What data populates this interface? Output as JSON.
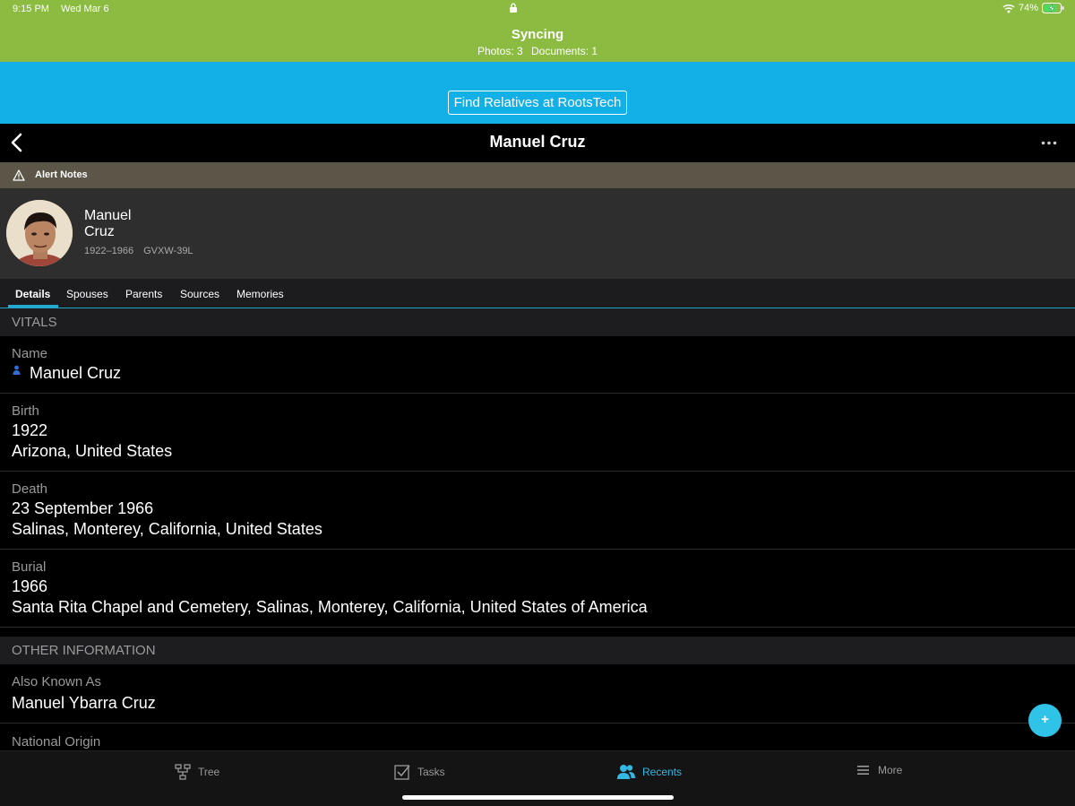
{
  "status_bar": {
    "time": "9:15 PM",
    "date": "Wed Mar 6",
    "battery": "74%"
  },
  "sync": {
    "title": "Syncing",
    "photos": "Photos: 3",
    "documents": "Documents: 1"
  },
  "promo": {
    "button_label": "Find Relatives at RootsTech"
  },
  "nav": {
    "title": "Manuel Cruz"
  },
  "alert": {
    "label": "Alert Notes"
  },
  "person": {
    "given_name": "Manuel",
    "surname": "Cruz",
    "lifespan": "1922–1966",
    "pid": "GVXW-39L"
  },
  "tabs": [
    {
      "label": "Details",
      "active": true
    },
    {
      "label": "Spouses"
    },
    {
      "label": "Parents"
    },
    {
      "label": "Sources"
    },
    {
      "label": "Memories"
    }
  ],
  "vitals": {
    "header": "VITALS",
    "name": {
      "label": "Name",
      "value": "Manuel Cruz"
    },
    "birth": {
      "label": "Birth",
      "date": "1922",
      "place": "Arizona, United States"
    },
    "death": {
      "label": "Death",
      "date": "23 September 1966",
      "place": "Salinas, Monterey, California, United States"
    },
    "burial": {
      "label": "Burial",
      "date": "1966",
      "place": "Santa Rita Chapel and Cemetery, Salinas, Monterey, California, United States of America"
    }
  },
  "other": {
    "header": "OTHER INFORMATION",
    "aka": {
      "label": "Also Known As",
      "value": "Manuel Ybarra Cruz"
    },
    "national_origin": {
      "label": "National Origin"
    }
  },
  "fab": {
    "label": "+"
  },
  "bottom_nav": [
    {
      "label": "Tree",
      "icon": "tree-icon"
    },
    {
      "label": "Tasks",
      "icon": "tasks-icon"
    },
    {
      "label": "Recents",
      "icon": "recents-icon",
      "active": true
    },
    {
      "label": "More",
      "icon": "more-menu-icon"
    }
  ],
  "colors": {
    "sync_green": "#8bbb41",
    "promo_blue": "#12b0e6",
    "accent": "#33b8e2",
    "alert_bg": "#5b5648"
  }
}
